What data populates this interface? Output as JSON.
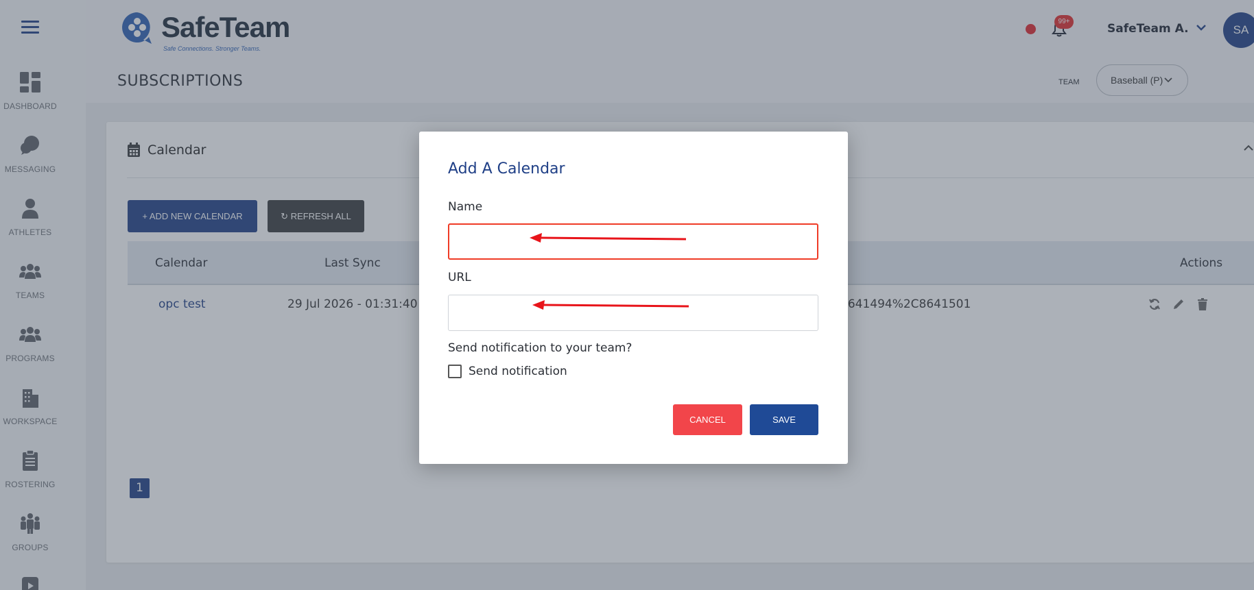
{
  "app": {
    "logo_text": "SafeTeam",
    "logo_tagline": "Safe Connections. Stronger Teams.",
    "brand_color": "#1f3f86"
  },
  "sidebar": {
    "items": [
      {
        "label": "DASHBOARD",
        "icon": "dashboard-icon"
      },
      {
        "label": "MESSAGING",
        "icon": "chat-bubbles-icon"
      },
      {
        "label": "ATHLETES",
        "icon": "user-icon"
      },
      {
        "label": "TEAMS",
        "icon": "users-icon"
      },
      {
        "label": "PROGRAMS",
        "icon": "users-icon"
      },
      {
        "label": "WORKSPACE",
        "icon": "building-icon"
      },
      {
        "label": "ROSTERING",
        "icon": "clipboard-icon"
      },
      {
        "label": "GROUPS",
        "icon": "group-icon"
      }
    ]
  },
  "header": {
    "page_title": "SUBSCRIPTIONS",
    "notification_count": "99+",
    "user_name": "SafeTeam A.",
    "avatar_initials": "SA",
    "team_label": "TEAM",
    "team_selected": "Baseball (P)"
  },
  "card": {
    "title": "Calendar",
    "add_button": "+ ADD NEW CALENDAR",
    "refresh_button": "REFRESH ALL",
    "columns": [
      "Calendar",
      "Last Sync",
      "Actions"
    ],
    "rows": [
      {
        "calendar": "opc test",
        "last_sync": "29 Jul 2026 - 01:31:40",
        "url_fragment": "8641494%2C8641501"
      }
    ],
    "page": "1"
  },
  "modal": {
    "title": "Add A Calendar",
    "name_label": "Name",
    "name_value": "",
    "url_label": "URL",
    "url_value": "",
    "notify_question": "Send notification to your team?",
    "notify_label": "Send notification",
    "notify_checked": false,
    "cancel_label": "CANCEL",
    "save_label": "SAVE",
    "cancel_color": "#f2454a",
    "save_color": "#1f4a96",
    "error_color": "#ef3b26"
  }
}
